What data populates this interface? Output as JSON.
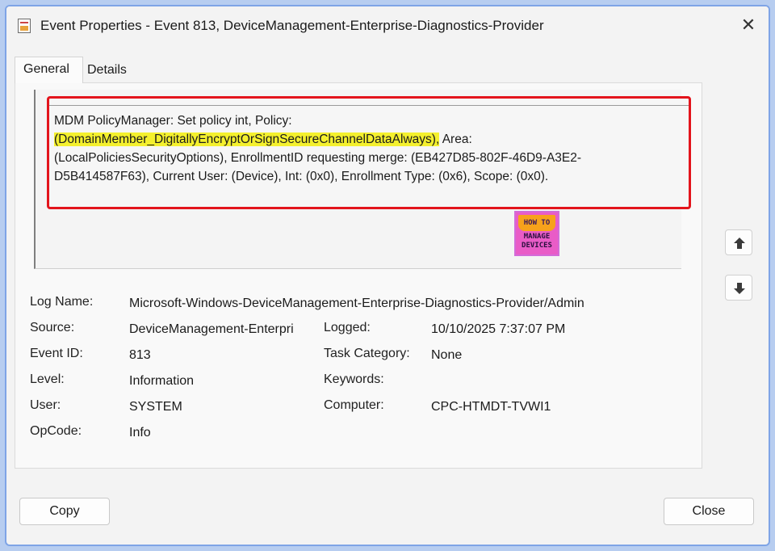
{
  "window": {
    "title": "Event Properties - Event 813, DeviceManagement-Enterprise-Diagnostics-Provider",
    "close_glyph": "✕"
  },
  "tabs": [
    {
      "label": "General",
      "active": true
    },
    {
      "label": "Details",
      "active": false
    }
  ],
  "message": {
    "line1": "MDM PolicyManager: Set policy int, Policy:",
    "highlighted": "(DomainMember_DigitallyEncryptOrSignSecureChannelDataAlways),",
    "line2_rest": " Area:",
    "line3": "(LocalPoliciesSecurityOptions), EnrollmentID requesting merge: (EB427D85-802F-46D9-A3E2-",
    "line4": "D5B414587F63), Current User: (Device), Int: (0x0), Enrollment Type: (0x6), Scope: (0x0).",
    "highlight_color": "#f4f02e",
    "annotation_color": "#e3141c"
  },
  "watermark": {
    "line1": "HOW TO",
    "line2": "MANAGE",
    "line3": "DEVICES"
  },
  "fields": {
    "log_name": {
      "label": "Log Name:",
      "value": "Microsoft-Windows-DeviceManagement-Enterprise-Diagnostics-Provider/Admin"
    },
    "source": {
      "label": "Source:",
      "value": "DeviceManagement-Enterpri"
    },
    "logged": {
      "label": "Logged:",
      "value": "10/10/2025 7:37:07 PM"
    },
    "event_id": {
      "label": "Event ID:",
      "value": "813"
    },
    "task_category": {
      "label": "Task Category:",
      "value": "None"
    },
    "level": {
      "label": "Level:",
      "value": "Information"
    },
    "keywords": {
      "label": "Keywords:",
      "value": ""
    },
    "user": {
      "label": "User:",
      "value": "SYSTEM"
    },
    "computer": {
      "label": "Computer:",
      "value": "CPC-HTMDT-TVWI1"
    },
    "opcode": {
      "label": "OpCode:",
      "value": "Info"
    }
  },
  "buttons": {
    "copy": "Copy",
    "close": "Close",
    "up_icon": "arrow-up-icon",
    "down_icon": "arrow-down-icon"
  }
}
